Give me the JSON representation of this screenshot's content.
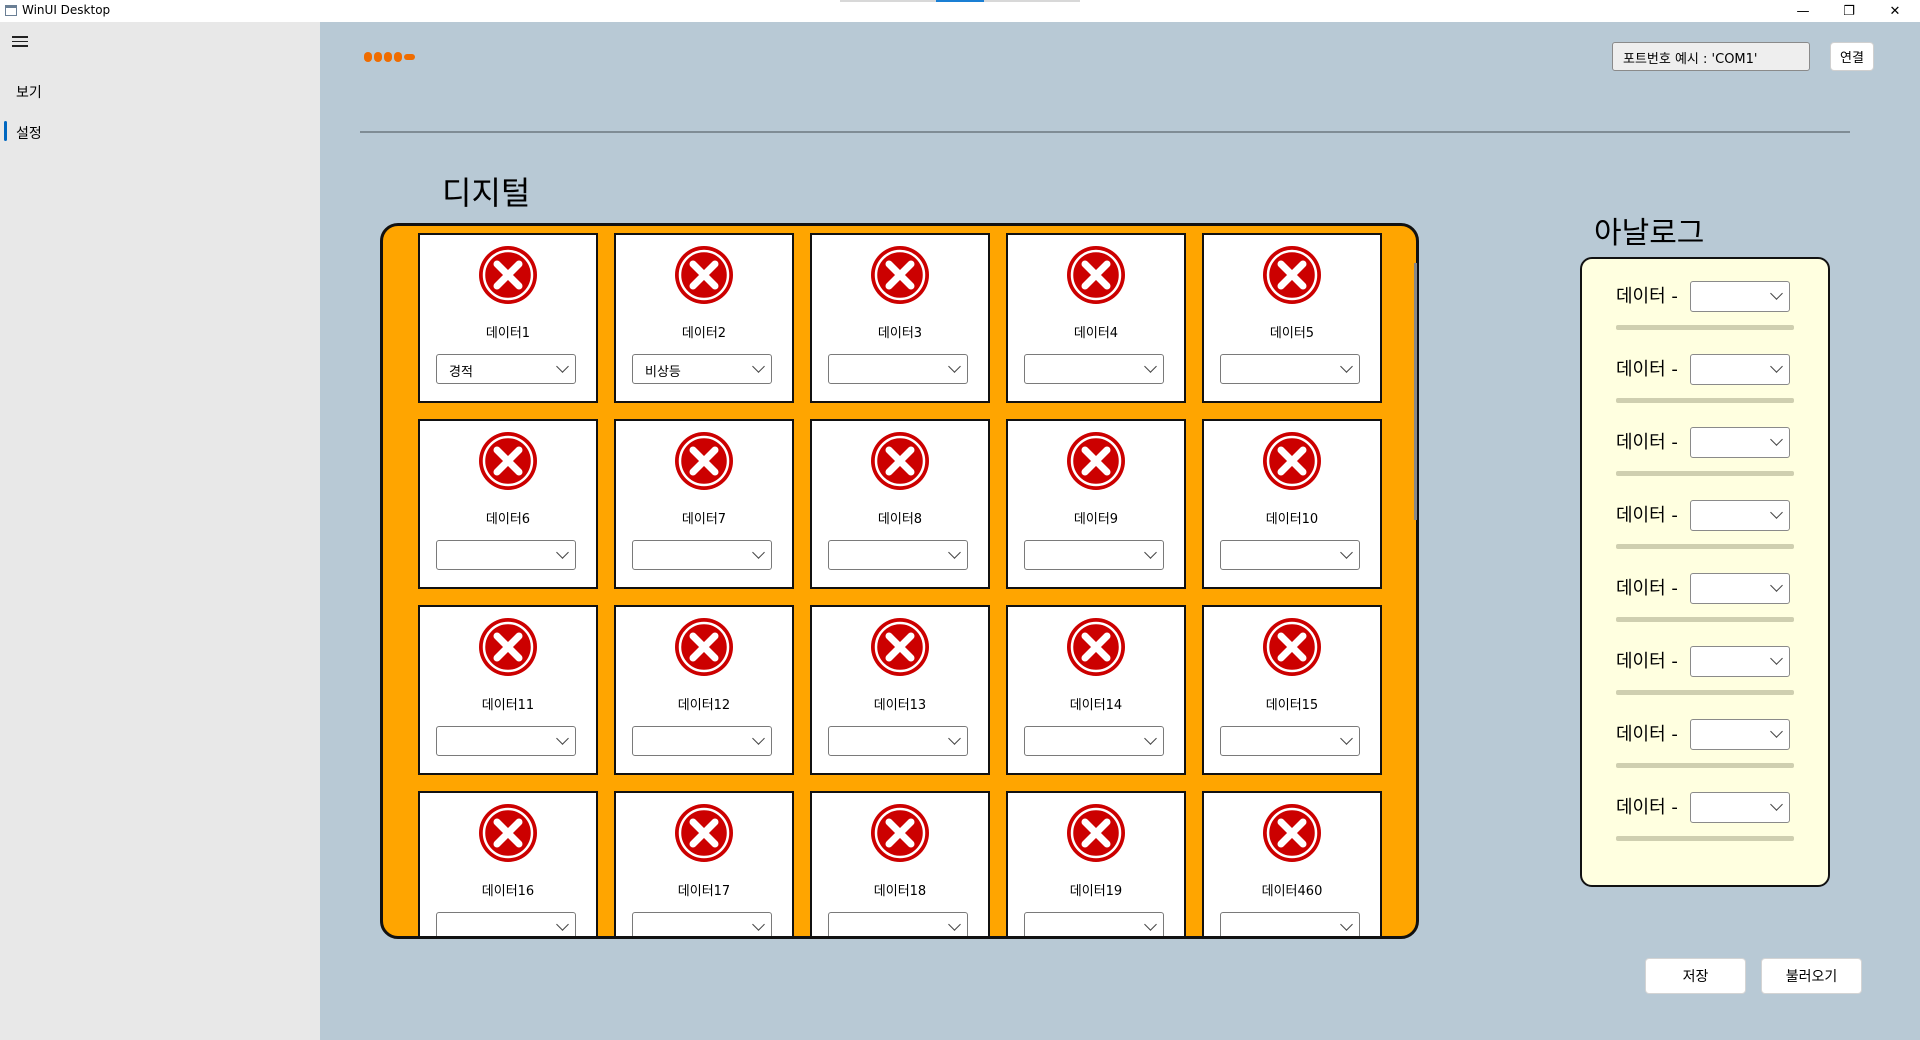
{
  "window": {
    "title": "WinUI Desktop",
    "minimize": "—",
    "restore": "❐",
    "close": "✕"
  },
  "sidebar": {
    "items": [
      {
        "label": "보기"
      },
      {
        "label": "설정"
      }
    ]
  },
  "header": {
    "port_placeholder": "포트번호 예시 : 'COM1'",
    "connect_label": "연결"
  },
  "digital": {
    "title": "디지털",
    "cards": [
      {
        "label": "데이터1",
        "value": "경적"
      },
      {
        "label": "데이터2",
        "value": "비상등"
      },
      {
        "label": "데이터3",
        "value": ""
      },
      {
        "label": "데이터4",
        "value": ""
      },
      {
        "label": "데이터5",
        "value": ""
      },
      {
        "label": "데이터6",
        "value": ""
      },
      {
        "label": "데이터7",
        "value": ""
      },
      {
        "label": "데이터8",
        "value": ""
      },
      {
        "label": "데이터9",
        "value": ""
      },
      {
        "label": "데이터10",
        "value": ""
      },
      {
        "label": "데이터11",
        "value": ""
      },
      {
        "label": "데이터12",
        "value": ""
      },
      {
        "label": "데이터13",
        "value": ""
      },
      {
        "label": "데이터14",
        "value": ""
      },
      {
        "label": "데이터15",
        "value": ""
      },
      {
        "label": "데이터16",
        "value": ""
      },
      {
        "label": "데이터17",
        "value": ""
      },
      {
        "label": "데이터18",
        "value": ""
      },
      {
        "label": "데이터19",
        "value": ""
      },
      {
        "label": "데이터460",
        "value": ""
      }
    ]
  },
  "analog": {
    "title": "아날로그",
    "rows": [
      {
        "label": "데이터 -"
      },
      {
        "label": "데이터 -"
      },
      {
        "label": "데이터 -"
      },
      {
        "label": "데이터 -"
      },
      {
        "label": "데이터 -"
      },
      {
        "label": "데이터 -"
      },
      {
        "label": "데이터 -"
      },
      {
        "label": "데이터 -"
      }
    ]
  },
  "footer": {
    "save_label": "저장",
    "load_label": "불러오기"
  },
  "colors": {
    "status_error": "#cc0000",
    "digital_panel": "#ffa500",
    "analog_panel": "#ffffe0",
    "main_bg": "#b8c9d5",
    "dots": "#ef6c00"
  },
  "icons": {
    "status": "error-x-icon"
  }
}
